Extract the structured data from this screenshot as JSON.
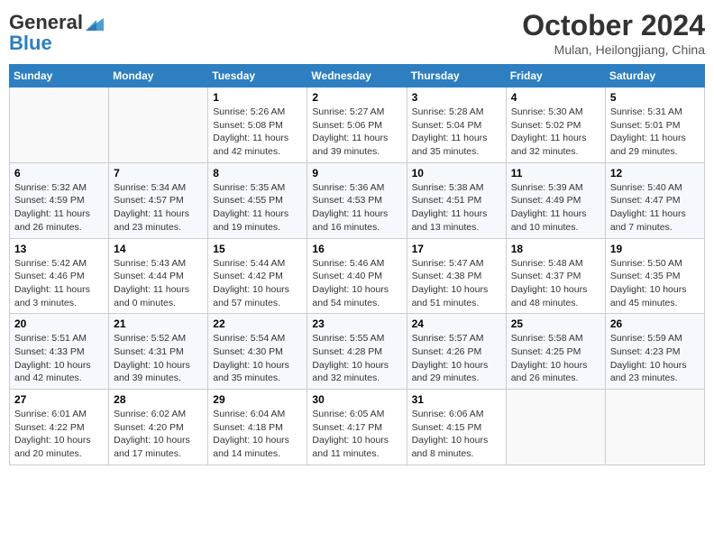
{
  "header": {
    "logo_general": "General",
    "logo_blue": "Blue",
    "month_title": "October 2024",
    "location": "Mulan, Heilongjiang, China"
  },
  "weekdays": [
    "Sunday",
    "Monday",
    "Tuesday",
    "Wednesday",
    "Thursday",
    "Friday",
    "Saturday"
  ],
  "weeks": [
    [
      {
        "day": "",
        "sunrise": "",
        "sunset": "",
        "daylight": ""
      },
      {
        "day": "",
        "sunrise": "",
        "sunset": "",
        "daylight": ""
      },
      {
        "day": "1",
        "sunrise": "Sunrise: 5:26 AM",
        "sunset": "Sunset: 5:08 PM",
        "daylight": "Daylight: 11 hours and 42 minutes."
      },
      {
        "day": "2",
        "sunrise": "Sunrise: 5:27 AM",
        "sunset": "Sunset: 5:06 PM",
        "daylight": "Daylight: 11 hours and 39 minutes."
      },
      {
        "day": "3",
        "sunrise": "Sunrise: 5:28 AM",
        "sunset": "Sunset: 5:04 PM",
        "daylight": "Daylight: 11 hours and 35 minutes."
      },
      {
        "day": "4",
        "sunrise": "Sunrise: 5:30 AM",
        "sunset": "Sunset: 5:02 PM",
        "daylight": "Daylight: 11 hours and 32 minutes."
      },
      {
        "day": "5",
        "sunrise": "Sunrise: 5:31 AM",
        "sunset": "Sunset: 5:01 PM",
        "daylight": "Daylight: 11 hours and 29 minutes."
      }
    ],
    [
      {
        "day": "6",
        "sunrise": "Sunrise: 5:32 AM",
        "sunset": "Sunset: 4:59 PM",
        "daylight": "Daylight: 11 hours and 26 minutes."
      },
      {
        "day": "7",
        "sunrise": "Sunrise: 5:34 AM",
        "sunset": "Sunset: 4:57 PM",
        "daylight": "Daylight: 11 hours and 23 minutes."
      },
      {
        "day": "8",
        "sunrise": "Sunrise: 5:35 AM",
        "sunset": "Sunset: 4:55 PM",
        "daylight": "Daylight: 11 hours and 19 minutes."
      },
      {
        "day": "9",
        "sunrise": "Sunrise: 5:36 AM",
        "sunset": "Sunset: 4:53 PM",
        "daylight": "Daylight: 11 hours and 16 minutes."
      },
      {
        "day": "10",
        "sunrise": "Sunrise: 5:38 AM",
        "sunset": "Sunset: 4:51 PM",
        "daylight": "Daylight: 11 hours and 13 minutes."
      },
      {
        "day": "11",
        "sunrise": "Sunrise: 5:39 AM",
        "sunset": "Sunset: 4:49 PM",
        "daylight": "Daylight: 11 hours and 10 minutes."
      },
      {
        "day": "12",
        "sunrise": "Sunrise: 5:40 AM",
        "sunset": "Sunset: 4:47 PM",
        "daylight": "Daylight: 11 hours and 7 minutes."
      }
    ],
    [
      {
        "day": "13",
        "sunrise": "Sunrise: 5:42 AM",
        "sunset": "Sunset: 4:46 PM",
        "daylight": "Daylight: 11 hours and 3 minutes."
      },
      {
        "day": "14",
        "sunrise": "Sunrise: 5:43 AM",
        "sunset": "Sunset: 4:44 PM",
        "daylight": "Daylight: 11 hours and 0 minutes."
      },
      {
        "day": "15",
        "sunrise": "Sunrise: 5:44 AM",
        "sunset": "Sunset: 4:42 PM",
        "daylight": "Daylight: 10 hours and 57 minutes."
      },
      {
        "day": "16",
        "sunrise": "Sunrise: 5:46 AM",
        "sunset": "Sunset: 4:40 PM",
        "daylight": "Daylight: 10 hours and 54 minutes."
      },
      {
        "day": "17",
        "sunrise": "Sunrise: 5:47 AM",
        "sunset": "Sunset: 4:38 PM",
        "daylight": "Daylight: 10 hours and 51 minutes."
      },
      {
        "day": "18",
        "sunrise": "Sunrise: 5:48 AM",
        "sunset": "Sunset: 4:37 PM",
        "daylight": "Daylight: 10 hours and 48 minutes."
      },
      {
        "day": "19",
        "sunrise": "Sunrise: 5:50 AM",
        "sunset": "Sunset: 4:35 PM",
        "daylight": "Daylight: 10 hours and 45 minutes."
      }
    ],
    [
      {
        "day": "20",
        "sunrise": "Sunrise: 5:51 AM",
        "sunset": "Sunset: 4:33 PM",
        "daylight": "Daylight: 10 hours and 42 minutes."
      },
      {
        "day": "21",
        "sunrise": "Sunrise: 5:52 AM",
        "sunset": "Sunset: 4:31 PM",
        "daylight": "Daylight: 10 hours and 39 minutes."
      },
      {
        "day": "22",
        "sunrise": "Sunrise: 5:54 AM",
        "sunset": "Sunset: 4:30 PM",
        "daylight": "Daylight: 10 hours and 35 minutes."
      },
      {
        "day": "23",
        "sunrise": "Sunrise: 5:55 AM",
        "sunset": "Sunset: 4:28 PM",
        "daylight": "Daylight: 10 hours and 32 minutes."
      },
      {
        "day": "24",
        "sunrise": "Sunrise: 5:57 AM",
        "sunset": "Sunset: 4:26 PM",
        "daylight": "Daylight: 10 hours and 29 minutes."
      },
      {
        "day": "25",
        "sunrise": "Sunrise: 5:58 AM",
        "sunset": "Sunset: 4:25 PM",
        "daylight": "Daylight: 10 hours and 26 minutes."
      },
      {
        "day": "26",
        "sunrise": "Sunrise: 5:59 AM",
        "sunset": "Sunset: 4:23 PM",
        "daylight": "Daylight: 10 hours and 23 minutes."
      }
    ],
    [
      {
        "day": "27",
        "sunrise": "Sunrise: 6:01 AM",
        "sunset": "Sunset: 4:22 PM",
        "daylight": "Daylight: 10 hours and 20 minutes."
      },
      {
        "day": "28",
        "sunrise": "Sunrise: 6:02 AM",
        "sunset": "Sunset: 4:20 PM",
        "daylight": "Daylight: 10 hours and 17 minutes."
      },
      {
        "day": "29",
        "sunrise": "Sunrise: 6:04 AM",
        "sunset": "Sunset: 4:18 PM",
        "daylight": "Daylight: 10 hours and 14 minutes."
      },
      {
        "day": "30",
        "sunrise": "Sunrise: 6:05 AM",
        "sunset": "Sunset: 4:17 PM",
        "daylight": "Daylight: 10 hours and 11 minutes."
      },
      {
        "day": "31",
        "sunrise": "Sunrise: 6:06 AM",
        "sunset": "Sunset: 4:15 PM",
        "daylight": "Daylight: 10 hours and 8 minutes."
      },
      {
        "day": "",
        "sunrise": "",
        "sunset": "",
        "daylight": ""
      },
      {
        "day": "",
        "sunrise": "",
        "sunset": "",
        "daylight": ""
      }
    ]
  ]
}
